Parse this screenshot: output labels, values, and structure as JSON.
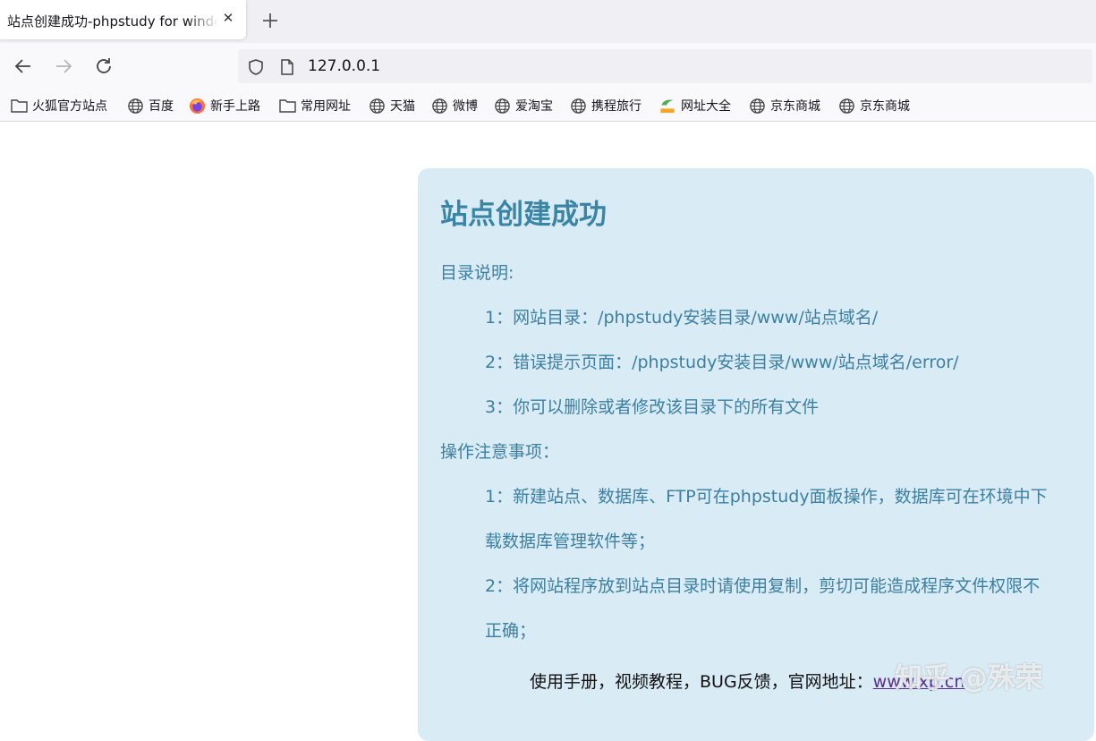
{
  "browser": {
    "tab": {
      "title": "站点创建成功-phpstudy for windows"
    },
    "address": {
      "url": "127.0.0.1"
    },
    "bookmarks": [
      {
        "label": "火狐官方站点",
        "icon": "folder-icon"
      },
      {
        "label": "百度",
        "icon": "globe-icon"
      },
      {
        "label": "新手上路",
        "icon": "firefox-icon"
      },
      {
        "label": "常用网址",
        "icon": "folder-icon"
      },
      {
        "label": "天猫",
        "icon": "globe-icon"
      },
      {
        "label": "微博",
        "icon": "globe-icon"
      },
      {
        "label": "爱淘宝",
        "icon": "globe-icon"
      },
      {
        "label": "携程旅行",
        "icon": "globe-icon"
      },
      {
        "label": "网址大全",
        "icon": "hao-icon"
      },
      {
        "label": "京东商城",
        "icon": "globe-icon"
      },
      {
        "label": "京东商城",
        "icon": "globe-icon"
      }
    ]
  },
  "page": {
    "title": "站点创建成功",
    "dir_heading": "目录说明:",
    "dir_items": [
      "1：网站目录：/phpstudy安装目录/www/站点域名/",
      "2：错误提示页面：/phpstudy安装目录/www/站点域名/error/",
      "3：你可以删除或者修改该目录下的所有文件"
    ],
    "notes_heading": "操作注意事项：",
    "note1_line1": "1：新建站点、数据库、FTP可在phpstudy面板操作，数据库可在环境中下",
    "note1_line2": "载数据库管理软件等；",
    "note2_line1": "2：将网站程序放到站点目录时请使用复制，剪切可能造成程序文件权限不",
    "note2_line2": "正确；",
    "footer_text": "使用手册，视频教程，BUG反馈，官网地址：",
    "footer_link": "www.xp.cn"
  },
  "watermark": "知乎 @殊荣",
  "colors": {
    "card_bg": "#d9ecf6",
    "title": "#3a84a6",
    "body_text": "#3c7fa0",
    "link": "#5b2d8e"
  }
}
